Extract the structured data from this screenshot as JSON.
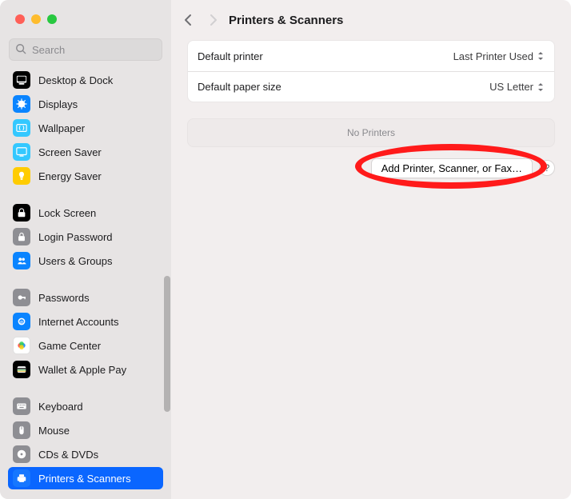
{
  "traffic": {
    "close": "close",
    "minimize": "minimize",
    "zoom": "zoom"
  },
  "search": {
    "placeholder": "Search"
  },
  "sidebar": {
    "groups": [
      {
        "items": [
          {
            "id": "desktop-dock",
            "label": "Desktop & Dock",
            "icon": "desktop-dock",
            "bg": "#000000"
          },
          {
            "id": "displays",
            "label": "Displays",
            "icon": "displays",
            "bg": "#0a84ff"
          },
          {
            "id": "wallpaper",
            "label": "Wallpaper",
            "icon": "wallpaper",
            "bg": "#34c8ff"
          },
          {
            "id": "screen-saver",
            "label": "Screen Saver",
            "icon": "screen-saver",
            "bg": "#34c8ff"
          },
          {
            "id": "energy-saver",
            "label": "Energy Saver",
            "icon": "energy-saver",
            "bg": "#ffcc00"
          }
        ]
      },
      {
        "items": [
          {
            "id": "lock-screen",
            "label": "Lock Screen",
            "icon": "lock-screen",
            "bg": "#000000"
          },
          {
            "id": "login-password",
            "label": "Login Password",
            "icon": "login-password",
            "bg": "#8e8e93"
          },
          {
            "id": "users-groups",
            "label": "Users & Groups",
            "icon": "users-groups",
            "bg": "#0a84ff"
          }
        ]
      },
      {
        "items": [
          {
            "id": "passwords",
            "label": "Passwords",
            "icon": "passwords",
            "bg": "#8e8e93"
          },
          {
            "id": "internet-accounts",
            "label": "Internet Accounts",
            "icon": "internet-accounts",
            "bg": "#0a84ff"
          },
          {
            "id": "game-center",
            "label": "Game Center",
            "icon": "game-center",
            "bg": "#ffffff"
          },
          {
            "id": "wallet-apple-pay",
            "label": "Wallet & Apple Pay",
            "icon": "wallet-apple-pay",
            "bg": "#000000"
          }
        ]
      },
      {
        "items": [
          {
            "id": "keyboard",
            "label": "Keyboard",
            "icon": "keyboard",
            "bg": "#8e8e93"
          },
          {
            "id": "mouse",
            "label": "Mouse",
            "icon": "mouse",
            "bg": "#8e8e93"
          },
          {
            "id": "cds-dvds",
            "label": "CDs & DVDs",
            "icon": "cds-dvds",
            "bg": "#8e8e93"
          },
          {
            "id": "printers-scanners",
            "label": "Printers & Scanners",
            "icon": "printers-scanners",
            "bg": "#1677ff",
            "selected": true
          }
        ]
      }
    ]
  },
  "header": {
    "title": "Printers & Scanners"
  },
  "settings": {
    "default_printer": {
      "label": "Default printer",
      "value": "Last Printer Used"
    },
    "default_paper_size": {
      "label": "Default paper size",
      "value": "US Letter"
    }
  },
  "printers_list": {
    "empty_label": "No Printers"
  },
  "actions": {
    "add_printer": "Add Printer, Scanner, or Fax…",
    "help": "?"
  },
  "annotation": {
    "type": "ellipse",
    "target": "add-printer-button"
  }
}
